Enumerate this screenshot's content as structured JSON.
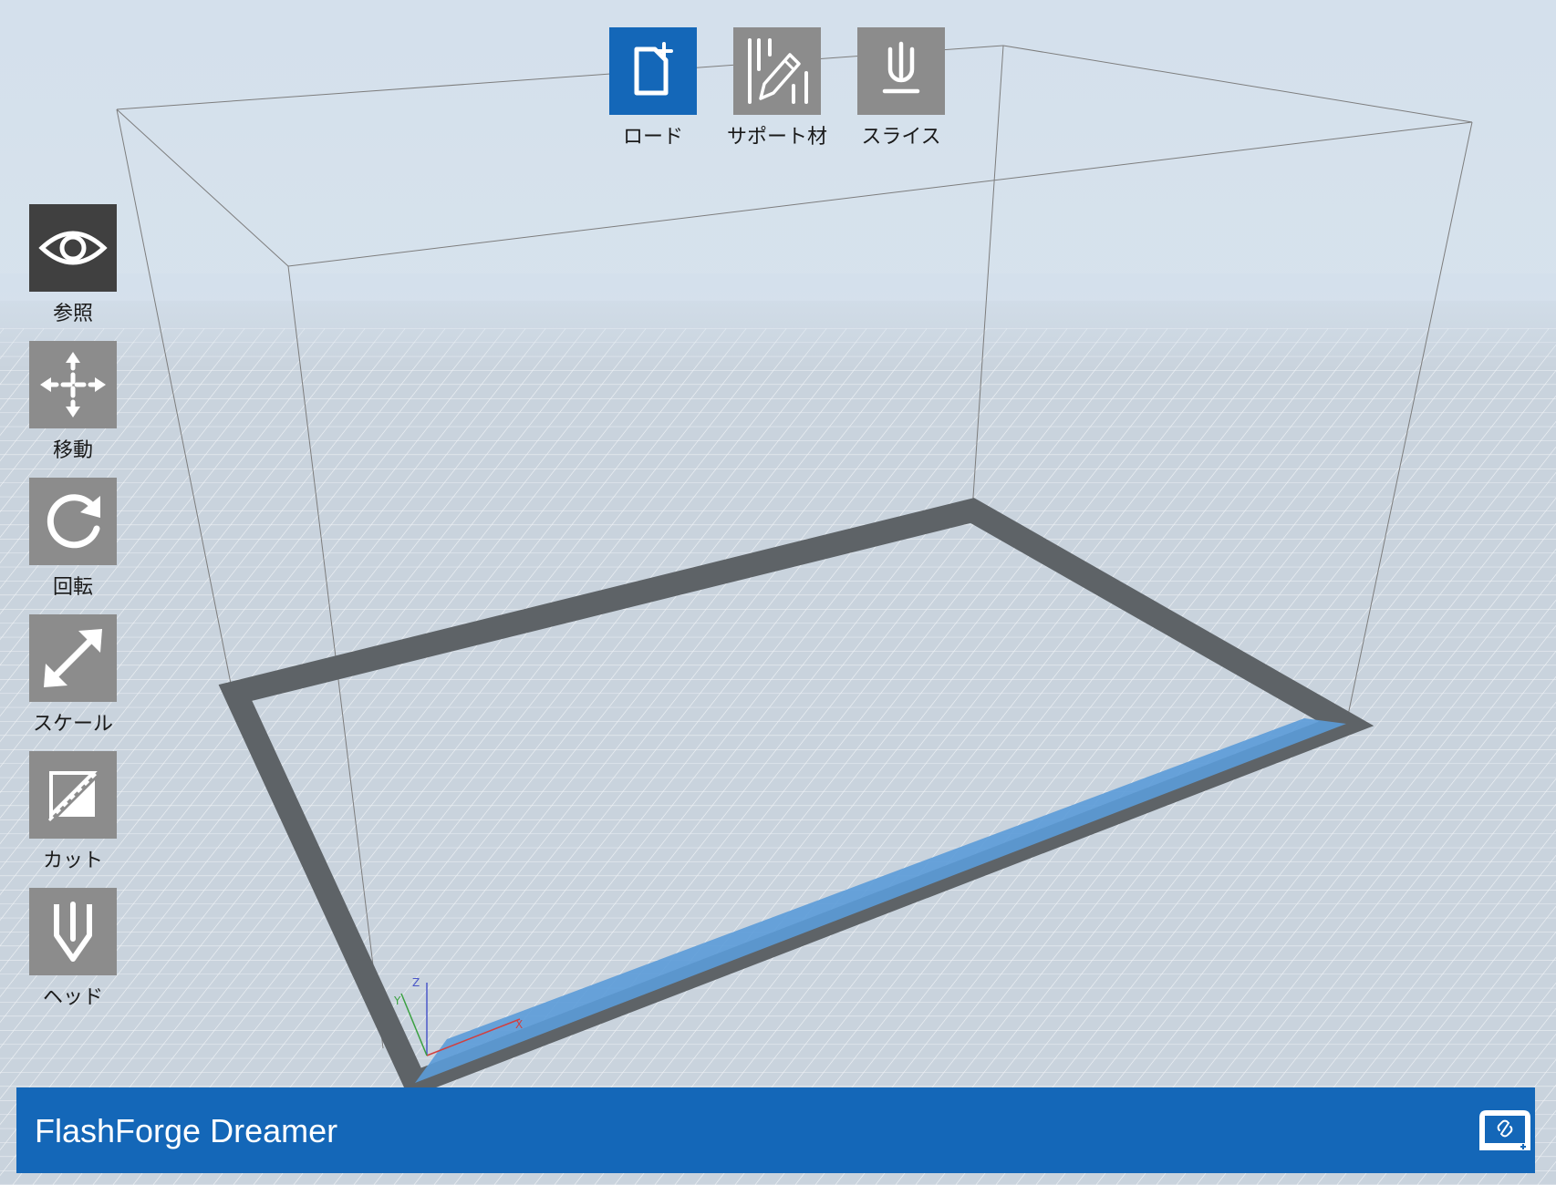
{
  "top_toolbar": {
    "load_label": "ロード",
    "support_label": "サポート材",
    "slice_label": "スライス"
  },
  "left_toolbar": {
    "view_label": "参照",
    "move_label": "移動",
    "rotate_label": "回転",
    "scale_label": "スケール",
    "cut_label": "カット",
    "head_label": "ヘッド"
  },
  "axis_gizmo": {
    "x_label": "X",
    "y_label": "Y",
    "z_label": "Z"
  },
  "status_bar": {
    "printer_name": "FlashForge Dreamer"
  },
  "colors": {
    "accent": "#1467b8",
    "tool_tile": "#8c8c8c",
    "tool_tile_selected": "#404040",
    "build_plate_border": "#5e6367",
    "front_edge_highlight": "#5b9bd8"
  },
  "icons": {
    "load": "file-add-icon",
    "support": "support-pencil-icon",
    "slice": "slice-icon",
    "view": "eye-icon",
    "move": "move-arrows-icon",
    "rotate": "rotate-icon",
    "scale": "scale-arrow-icon",
    "cut": "cut-icon",
    "head": "nozzle-icon",
    "printer": "printer-connect-icon"
  }
}
